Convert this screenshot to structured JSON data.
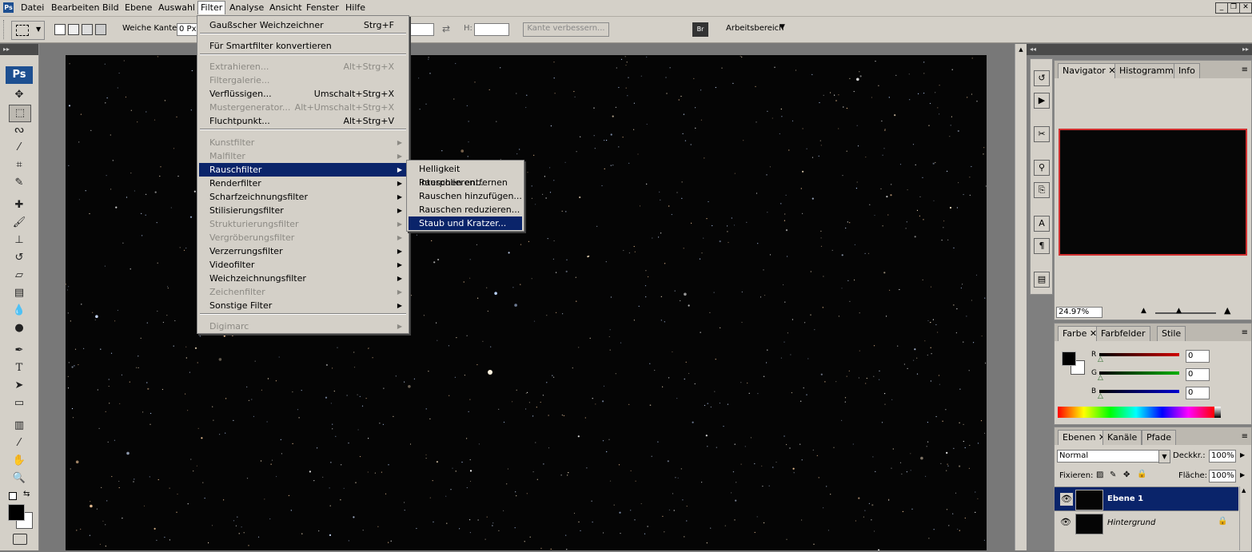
{
  "menubar": {
    "items": [
      "Datei",
      "Bearbeiten",
      "Bild",
      "Ebene",
      "Auswahl",
      "Filter",
      "Analyse",
      "Ansicht",
      "Fenster",
      "Hilfe"
    ],
    "active": "Filter"
  },
  "options_bar": {
    "feather_label": "Weiche Kante:",
    "feather_value": "0 Px",
    "h_label": "H:",
    "refine_edge_label": "Kante verbessern...",
    "workspace_label": "Arbeitsbereich"
  },
  "filter_menu": {
    "items": [
      {
        "label": "Gaußscher Weichzeichner",
        "shortcut": "Strg+F",
        "enabled": true
      },
      {
        "label": "Für Smartfilter konvertieren",
        "enabled": true
      },
      {
        "label": "Extrahieren...",
        "shortcut": "Alt+Strg+X",
        "enabled": false
      },
      {
        "label": "Filtergalerie...",
        "enabled": false
      },
      {
        "label": "Verflüssigen...",
        "shortcut": "Umschalt+Strg+X",
        "enabled": true
      },
      {
        "label": "Mustergenerator...",
        "shortcut": "Alt+Umschalt+Strg+X",
        "enabled": false
      },
      {
        "label": "Fluchtpunkt...",
        "shortcut": "Alt+Strg+V",
        "enabled": true
      },
      {
        "label": "Kunstfilter",
        "submenu": true,
        "enabled": false
      },
      {
        "label": "Malfilter",
        "submenu": true,
        "enabled": false
      },
      {
        "label": "Rauschfilter",
        "submenu": true,
        "enabled": true,
        "highlighted": true
      },
      {
        "label": "Renderfilter",
        "submenu": true,
        "enabled": true
      },
      {
        "label": "Scharfzeichnungsfilter",
        "submenu": true,
        "enabled": true
      },
      {
        "label": "Stilisierungsfilter",
        "submenu": true,
        "enabled": true
      },
      {
        "label": "Strukturierungsfilter",
        "submenu": true,
        "enabled": false
      },
      {
        "label": "Vergröberungsfilter",
        "submenu": true,
        "enabled": false
      },
      {
        "label": "Verzerrungsfilter",
        "submenu": true,
        "enabled": true
      },
      {
        "label": "Videofilter",
        "submenu": true,
        "enabled": true
      },
      {
        "label": "Weichzeichnungsfilter",
        "submenu": true,
        "enabled": true
      },
      {
        "label": "Zeichenfilter",
        "submenu": true,
        "enabled": false
      },
      {
        "label": "Sonstige Filter",
        "submenu": true,
        "enabled": true
      },
      {
        "label": "Digimarc",
        "submenu": true,
        "enabled": false
      }
    ]
  },
  "noise_submenu": {
    "items": [
      {
        "label": "Helligkeit interpolieren..."
      },
      {
        "label": "Rauschen entfernen"
      },
      {
        "label": "Rauschen hinzufügen..."
      },
      {
        "label": "Rauschen reduzieren..."
      },
      {
        "label": "Staub und Kratzer...",
        "highlighted": true
      }
    ]
  },
  "toolbox": {
    "logo": "Ps",
    "tools": [
      "move-icon",
      "marquee-icon",
      "lasso-icon",
      "magic-wand-icon",
      "crop-icon",
      "slice-icon",
      "healing-icon",
      "brush-icon",
      "stamp-icon",
      "history-brush-icon",
      "eraser-icon",
      "gradient-icon",
      "blur-icon",
      "dodge-icon",
      "pen-icon",
      "type-icon",
      "path-select-icon",
      "shape-icon",
      "notes-icon",
      "eyedropper-icon",
      "hand-icon",
      "zoom-icon"
    ]
  },
  "navigator_panel": {
    "tabs": [
      "Navigator",
      "Histogramm",
      "Info"
    ],
    "zoom": "24.97%"
  },
  "color_panel": {
    "tabs": [
      "Farbe",
      "Farbfelder",
      "Stile"
    ],
    "channels": [
      {
        "label": "R",
        "value": "0",
        "color": "#d00000"
      },
      {
        "label": "G",
        "value": "0",
        "color": "#00b000"
      },
      {
        "label": "B",
        "value": "0",
        "color": "#0000d0"
      }
    ]
  },
  "layers_panel": {
    "tabs": [
      "Ebenen",
      "Kanäle",
      "Pfade"
    ],
    "blend_mode": "Normal",
    "opacity_label": "Deckkr.:",
    "opacity_value": "100%",
    "lock_label": "Fixieren:",
    "fill_label": "Fläche:",
    "fill_value": "100%",
    "layers": [
      {
        "name": "Ebene 1",
        "selected": true
      },
      {
        "name": "Hintergrund",
        "locked": true
      }
    ]
  },
  "colors": {
    "menu_highlight": "#0a246a",
    "chrome": "#d4d0c8",
    "canvas_bg": "#050505"
  }
}
